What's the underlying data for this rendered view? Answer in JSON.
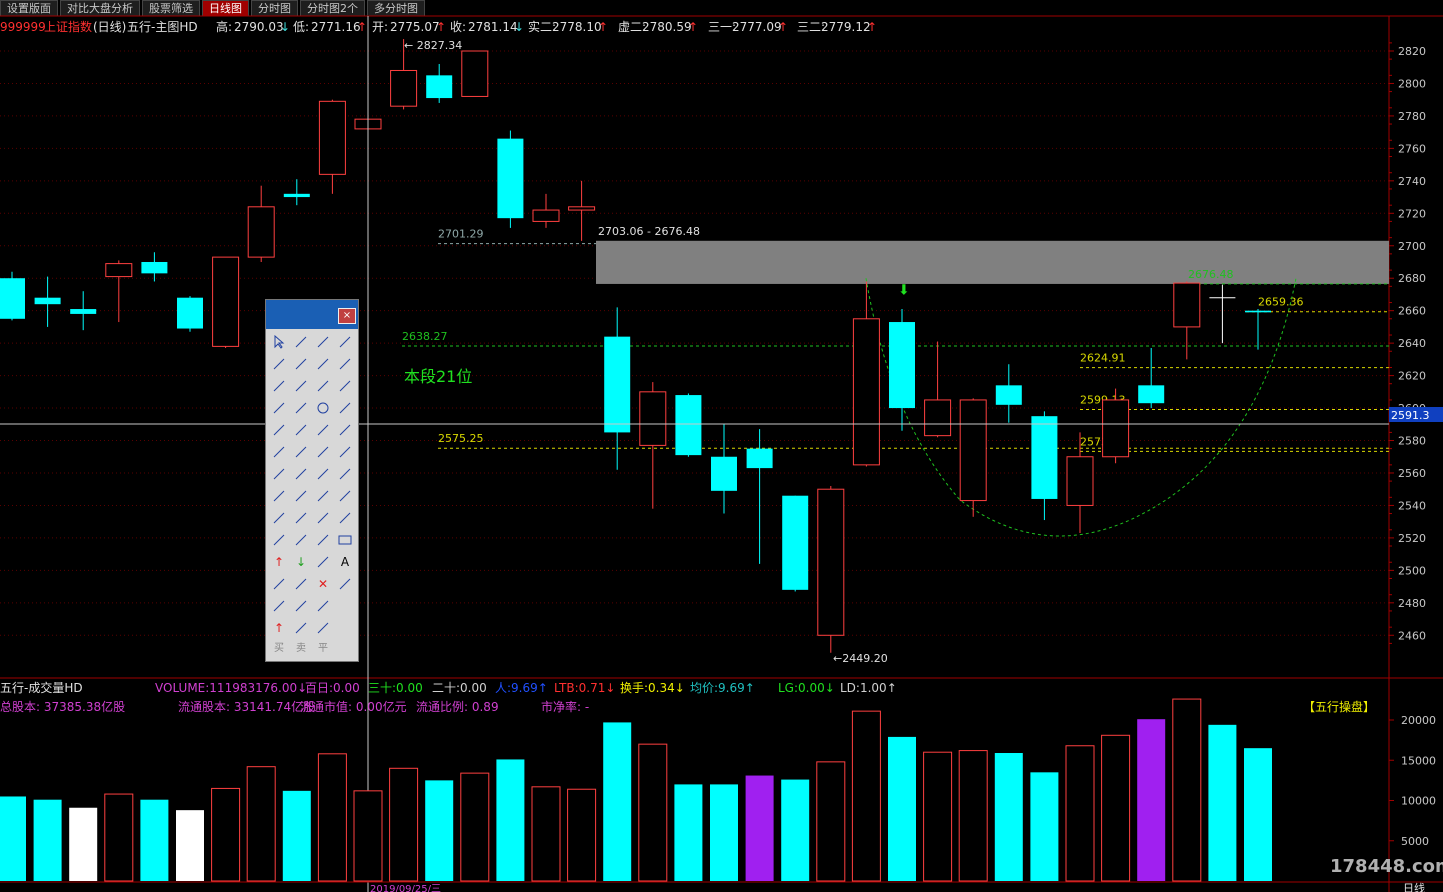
{
  "tabs": [
    "设置版面",
    "对比大盘分析",
    "股票筛选",
    "日线图",
    "分时图",
    "分时图2个",
    "多分时图"
  ],
  "active_tab": 3,
  "header": {
    "code": "999999",
    "name": "上证指数",
    "period": "(日线)",
    "indicator": "五行-主图HD",
    "stats": [
      {
        "label": "高:",
        "value": "2790.03",
        "arrow": "↓"
      },
      {
        "label": "低:",
        "value": "2771.16",
        "arrow": "↑"
      },
      {
        "label": "开:",
        "value": "2775.07",
        "arrow": "↑"
      },
      {
        "label": "收:",
        "value": "2781.14",
        "arrow": "↓"
      },
      {
        "label": "实二:",
        "value": "2778.10",
        "arrow": "↑"
      },
      {
        "label": "虚二:",
        "value": "2780.59",
        "arrow": "↑"
      },
      {
        "label": "三一:",
        "value": "2777.09",
        "arrow": "↑"
      },
      {
        "label": "三二:",
        "value": "2779.12",
        "arrow": "↑"
      }
    ]
  },
  "price_axis": {
    "ticks": [
      2820,
      2800,
      2780,
      2760,
      2740,
      2720,
      2700,
      2680,
      2660,
      2640,
      2620,
      2600,
      2580,
      2560,
      2540,
      2520,
      2500,
      2480,
      2460
    ],
    "current": "2591.3"
  },
  "annotations": {
    "high": "2827.34",
    "low": "2449.20",
    "zone": "2703.06 - 2676.48",
    "zone_top": 2703.06,
    "zone_bottom": 2676.48,
    "segment": "本段21位",
    "levels": [
      {
        "text": "2701.29",
        "value": 2701.29,
        "color": "#8fa8a8"
      },
      {
        "text": "2638.27",
        "value": 2638.27,
        "color": "#1fc01f"
      },
      {
        "text": "2575.25",
        "value": 2575.25,
        "color": "#d8d800"
      },
      {
        "text": "2676.48",
        "value": 2676.48,
        "color": "#1fc01f"
      },
      {
        "text": "2659.36",
        "value": 2659.36,
        "color": "#d8d800"
      },
      {
        "text": "2624.91",
        "value": 2624.91,
        "color": "#d8d800"
      },
      {
        "text": "2599.13",
        "value": 2599.13,
        "color": "#d8d800"
      },
      {
        "text": "2573.35",
        "value": 2573.35,
        "color": "#d8d800"
      }
    ]
  },
  "candles": [
    {
      "o": 2680,
      "c": 2655,
      "h": 2684,
      "l": 2654,
      "t": "down"
    },
    {
      "o": 2668,
      "c": 2664,
      "h": 2681,
      "l": 2650,
      "t": "down"
    },
    {
      "o": 2661,
      "c": 2658,
      "h": 2672,
      "l": 2648,
      "t": "down"
    },
    {
      "o": 2681,
      "c": 2689,
      "h": 2691,
      "l": 2653,
      "t": "up"
    },
    {
      "o": 2690,
      "c": 2683,
      "h": 2696,
      "l": 2678,
      "t": "down"
    },
    {
      "o": 2668,
      "c": 2649,
      "h": 2669,
      "l": 2647,
      "t": "down"
    },
    {
      "o": 2638,
      "c": 2693,
      "h": 2693,
      "l": 2637,
      "t": "up"
    },
    {
      "o": 2693,
      "c": 2724,
      "h": 2737,
      "l": 2690,
      "t": "up"
    },
    {
      "o": 2732,
      "c": 2730,
      "h": 2741,
      "l": 2725,
      "t": "down"
    },
    {
      "o": 2744,
      "c": 2789,
      "h": 2790,
      "l": 2732,
      "t": "up"
    },
    {
      "o": 2772,
      "c": 2778,
      "h": 2786,
      "l": 2771,
      "t": "up"
    },
    {
      "o": 2786,
      "c": 2808,
      "h": 2827.34,
      "l": 2784,
      "t": "up"
    },
    {
      "o": 2805,
      "c": 2791,
      "h": 2812,
      "l": 2788,
      "t": "down"
    },
    {
      "o": 2792,
      "c": 2820,
      "h": 2820,
      "l": 2792,
      "t": "up"
    },
    {
      "o": 2766,
      "c": 2717,
      "h": 2771,
      "l": 2711,
      "t": "down"
    },
    {
      "o": 2715,
      "c": 2722,
      "h": 2732,
      "l": 2711,
      "t": "up"
    },
    {
      "o": 2722,
      "c": 2724,
      "h": 2740,
      "l": 2703,
      "t": "up"
    },
    {
      "o": 2644,
      "c": 2585,
      "h": 2662,
      "l": 2562,
      "t": "down"
    },
    {
      "o": 2577,
      "c": 2610,
      "h": 2616,
      "l": 2538,
      "t": "up"
    },
    {
      "o": 2608,
      "c": 2571,
      "h": 2609,
      "l": 2570,
      "t": "down"
    },
    {
      "o": 2570,
      "c": 2549,
      "h": 2590,
      "l": 2535,
      "t": "down"
    },
    {
      "o": 2575,
      "c": 2563,
      "h": 2587,
      "l": 2504,
      "t": "down"
    },
    {
      "o": 2546,
      "c": 2488,
      "h": 2546,
      "l": 2487,
      "t": "down"
    },
    {
      "o": 2460,
      "c": 2550,
      "h": 2552,
      "l": 2449.2,
      "t": "up"
    },
    {
      "o": 2565,
      "c": 2655,
      "h": 2678,
      "l": 2564,
      "t": "up"
    },
    {
      "o": 2653,
      "c": 2600,
      "h": 2661,
      "l": 2586,
      "t": "down"
    },
    {
      "o": 2583,
      "c": 2605,
      "h": 2641,
      "l": 2582,
      "t": "up"
    },
    {
      "o": 2543,
      "c": 2605,
      "h": 2606,
      "l": 2533,
      "t": "up"
    },
    {
      "o": 2614,
      "c": 2602,
      "h": 2627,
      "l": 2591,
      "t": "down"
    },
    {
      "o": 2595,
      "c": 2544,
      "h": 2598,
      "l": 2531,
      "t": "down"
    },
    {
      "o": 2540,
      "c": 2570,
      "h": 2585,
      "l": 2523,
      "t": "up"
    },
    {
      "o": 2570,
      "c": 2605,
      "h": 2612,
      "l": 2566,
      "t": "up"
    },
    {
      "o": 2603,
      "c": 2614,
      "h": 2637,
      "l": 2600,
      "t": "down"
    },
    {
      "o": 2650,
      "c": 2677,
      "h": 2678,
      "l": 2630,
      "t": "up"
    },
    {
      "o": 2668,
      "c": 2668,
      "h": 2676,
      "l": 2640,
      "t": "cross"
    },
    {
      "o": 2660,
      "c": 2659,
      "h": 2661,
      "l": 2636,
      "t": "down"
    }
  ],
  "volume_panel": {
    "title": "五行-成交量HD",
    "items": [
      {
        "label": "VOLUME:",
        "value": "111983176.00",
        "arrow": "↓",
        "color": "#d040d0"
      },
      {
        "label": "百日:",
        "value": "0.00",
        "arrow": "",
        "color": "#d040d0"
      },
      {
        "label": "三十:",
        "value": "0.00",
        "arrow": "",
        "color": "#20e020"
      },
      {
        "label": "二十:",
        "value": "0.00",
        "arrow": "",
        "color": "#d0d0d0"
      },
      {
        "label": "人:",
        "value": "9.69",
        "arrow": "↑",
        "color": "#2050ff"
      },
      {
        "label": "LTB:",
        "value": "0.71",
        "arrow": "↓",
        "color": "#ff3030"
      },
      {
        "label": "换手:",
        "value": "0.34",
        "arrow": "↓",
        "color": "#f0f000"
      },
      {
        "label": "均价:",
        "value": "9.69",
        "arrow": "↑",
        "color": "#20c0c0"
      },
      {
        "label": "LG:",
        "value": "0.00",
        "arrow": "↓",
        "color": "#20e020"
      },
      {
        "label": "LD:",
        "value": "1.00",
        "arrow": "↑",
        "color": "#d0d0d0"
      }
    ],
    "info": [
      {
        "label": "总股本:",
        "value": "37385.38亿股"
      },
      {
        "label": "流通股本:",
        "value": "33141.74亿股"
      },
      {
        "label": "流通市值:",
        "value": "0.00亿元"
      },
      {
        "label": "流通比例:",
        "value": "0.89"
      },
      {
        "label": "市净率:",
        "value": "-"
      }
    ],
    "brand": "【五行操盘】",
    "ticks": [
      20000,
      15000,
      10000,
      5000
    ],
    "bars": [
      {
        "v": 10500,
        "c": "cyan"
      },
      {
        "v": 10100,
        "c": "cyan"
      },
      {
        "v": 9100,
        "c": "white"
      },
      {
        "v": 10800,
        "c": "up"
      },
      {
        "v": 10100,
        "c": "cyan"
      },
      {
        "v": 8800,
        "c": "white"
      },
      {
        "v": 11500,
        "c": "up"
      },
      {
        "v": 14200,
        "c": "up"
      },
      {
        "v": 11200,
        "c": "cyan"
      },
      {
        "v": 15800,
        "c": "up"
      },
      {
        "v": 11200,
        "c": "up"
      },
      {
        "v": 14000,
        "c": "up"
      },
      {
        "v": 12500,
        "c": "cyan"
      },
      {
        "v": 13400,
        "c": "up"
      },
      {
        "v": 15100,
        "c": "cyan"
      },
      {
        "v": 11700,
        "c": "up"
      },
      {
        "v": 11400,
        "c": "up"
      },
      {
        "v": 19700,
        "c": "cyan"
      },
      {
        "v": 17000,
        "c": "up"
      },
      {
        "v": 12000,
        "c": "cyan"
      },
      {
        "v": 12000,
        "c": "cyan"
      },
      {
        "v": 13100,
        "c": "purple"
      },
      {
        "v": 12600,
        "c": "cyan"
      },
      {
        "v": 14800,
        "c": "up"
      },
      {
        "v": 21100,
        "c": "up"
      },
      {
        "v": 17900,
        "c": "cyan"
      },
      {
        "v": 16000,
        "c": "up"
      },
      {
        "v": 16200,
        "c": "up"
      },
      {
        "v": 15900,
        "c": "cyan"
      },
      {
        "v": 13500,
        "c": "cyan"
      },
      {
        "v": 16800,
        "c": "up"
      },
      {
        "v": 18100,
        "c": "up"
      },
      {
        "v": 20100,
        "c": "purple"
      },
      {
        "v": 22600,
        "c": "up"
      },
      {
        "v": 19400,
        "c": "cyan"
      },
      {
        "v": 16500,
        "c": "cyan"
      }
    ]
  },
  "footer": {
    "date": "2019/09/25/三",
    "period_label": "日线",
    "watermark": "178448.com"
  },
  "colors": {
    "up": "#ff4040",
    "down": "#00ffff",
    "grid": "#5a0000",
    "axis": "#a00000",
    "purple": "#a020f0"
  },
  "toolbox": {
    "close": "×",
    "bottom": [
      "买",
      "卖",
      "平"
    ]
  }
}
